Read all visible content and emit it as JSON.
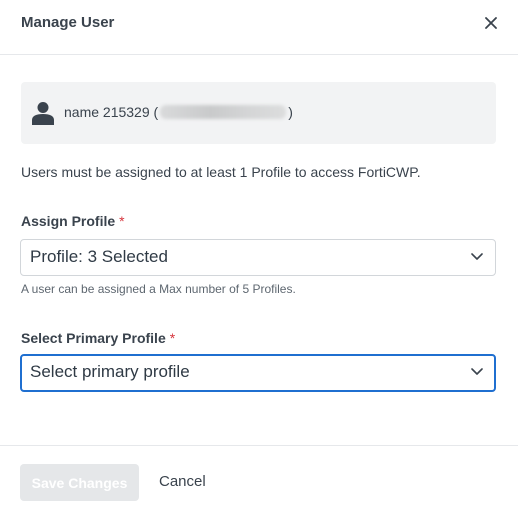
{
  "dialog": {
    "title": "Manage User",
    "close_icon": "close-icon"
  },
  "user": {
    "icon": "user-icon",
    "name_prefix": "name 215329 (",
    "name_suffix": ")"
  },
  "info_text": "Users must be assigned to at least 1 Profile to access FortiCWP.",
  "assign_profile": {
    "label": "Assign Profile",
    "required_marker": "*",
    "value": "Profile: 3 Selected",
    "hint": "A user can be assigned a Max number of 5 Profiles."
  },
  "primary_profile": {
    "label": "Select Primary Profile",
    "required_marker": "*",
    "placeholder": "Select primary profile",
    "focused": true
  },
  "footer": {
    "save_label": "Save Changes",
    "save_disabled": true,
    "cancel_label": "Cancel"
  },
  "colors": {
    "focus_border": "#1f6fd0",
    "required": "#d6343c",
    "disabled_button_bg": "#e5e7e9"
  }
}
